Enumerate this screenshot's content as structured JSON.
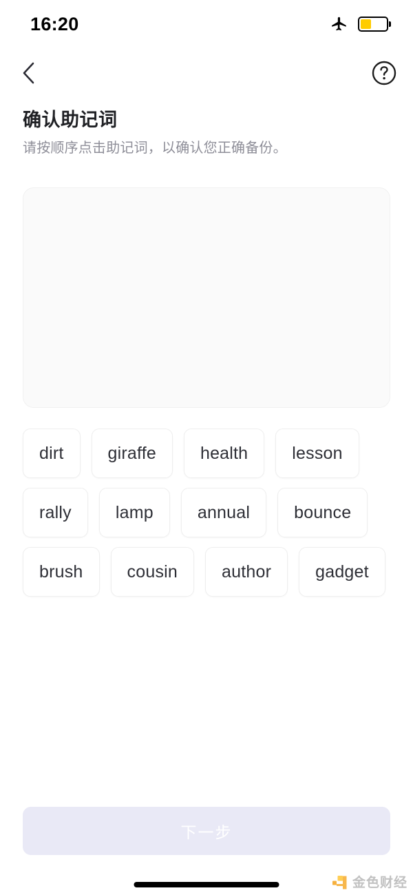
{
  "status_bar": {
    "time": "16:20",
    "airplane_icon": "airplane-icon",
    "battery_icon": "battery-icon",
    "battery_level_percent": 42,
    "battery_color": "#FFCC00"
  },
  "nav_bar": {
    "back_icon": "chevron-left-icon",
    "help_icon": "question-circle-icon"
  },
  "header": {
    "title": "确认助记词",
    "subtitle": "请按顺序点击助记词，以确认您正确备份。"
  },
  "dropzone": {
    "selected_words": []
  },
  "word_bank": {
    "words": [
      "dirt",
      "giraffe",
      "health",
      "lesson",
      "rally",
      "lamp",
      "annual",
      "bounce",
      "brush",
      "cousin",
      "author",
      "gadget"
    ]
  },
  "footer": {
    "next_label": "下一步",
    "next_enabled": false,
    "next_bg_color": "#e9e9f6",
    "next_text_color": "#ffffff"
  },
  "watermark": {
    "text": "金色财经",
    "mark_color": "#F5A623",
    "mark_color_alt": "#FFC83D"
  }
}
